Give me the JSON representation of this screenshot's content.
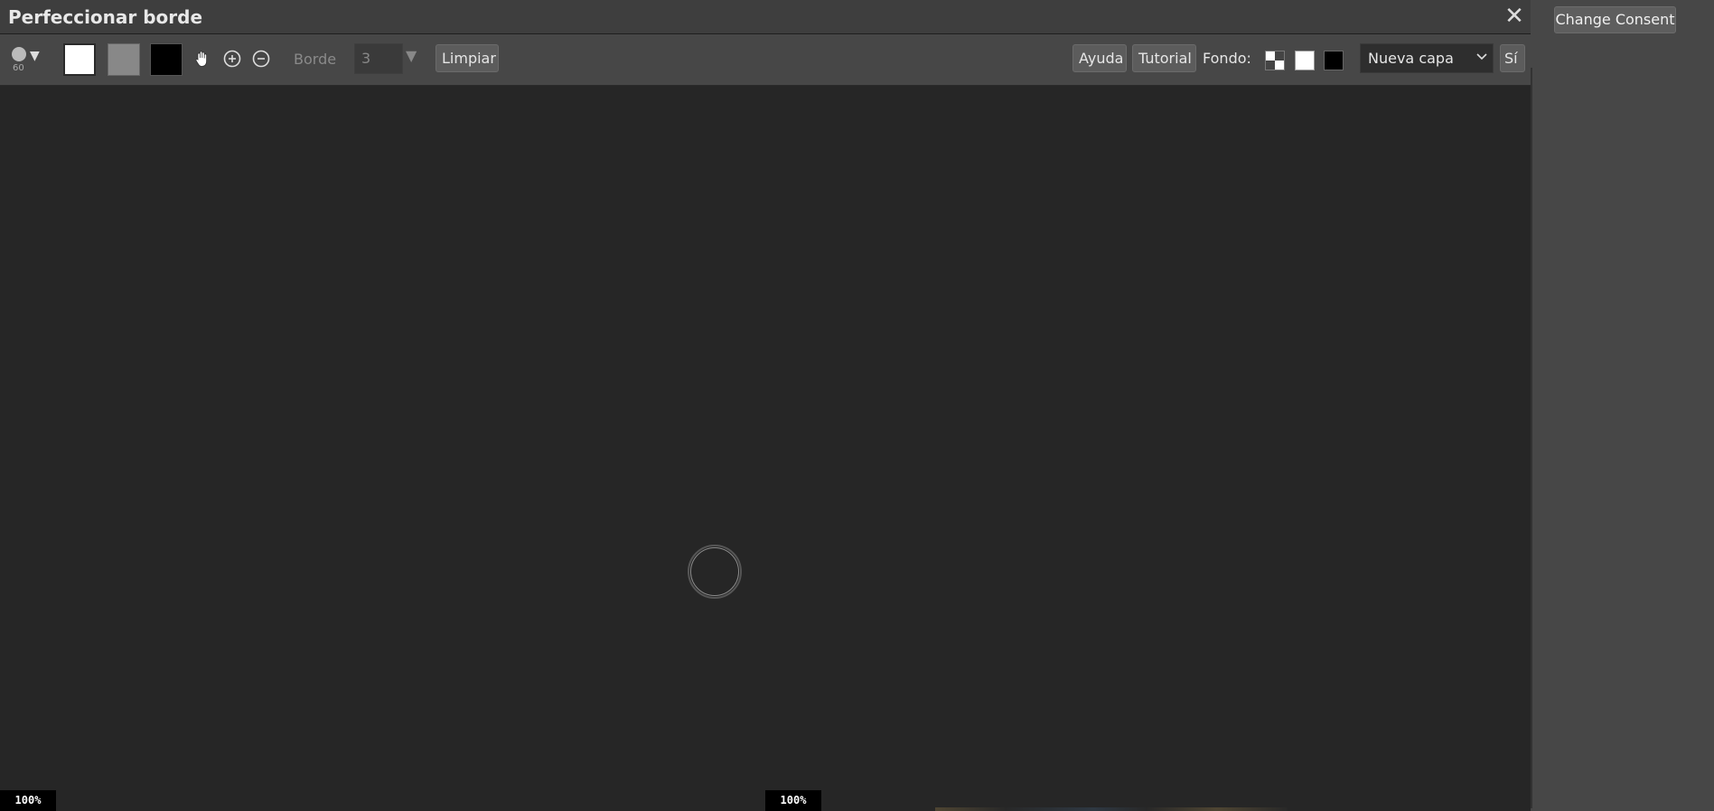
{
  "dialog": {
    "title": "Perfeccionar borde",
    "close_glyph": "✕"
  },
  "toolbar": {
    "brush": {
      "size": "60",
      "arrow": "▼",
      "icon": "brush-circle-icon"
    },
    "swatches": [
      {
        "name": "white",
        "color": "#ffffff"
      },
      {
        "name": "gray",
        "color": "#888888"
      },
      {
        "name": "black",
        "color": "#000000"
      }
    ],
    "icons": [
      "hand-icon",
      "zoom-in-icon",
      "zoom-out-icon"
    ],
    "borde_label": "Borde",
    "borde_value": "3",
    "borde_arrow": "▼",
    "limpiar_label": "Limpiar",
    "ayuda_label": "Ayuda",
    "tutorial_label": "Tutorial",
    "fondo_label": "Fondo:",
    "fondo_options": [
      "transparent",
      "white",
      "black"
    ],
    "layer_select": {
      "selected": "Nueva capa",
      "chevron": "⌄"
    },
    "confirm_label": "Sí"
  },
  "canvas": {
    "zoom_left": "100%",
    "zoom_right": "100%"
  },
  "sidebar": {
    "consent_label": "Change Consent"
  }
}
